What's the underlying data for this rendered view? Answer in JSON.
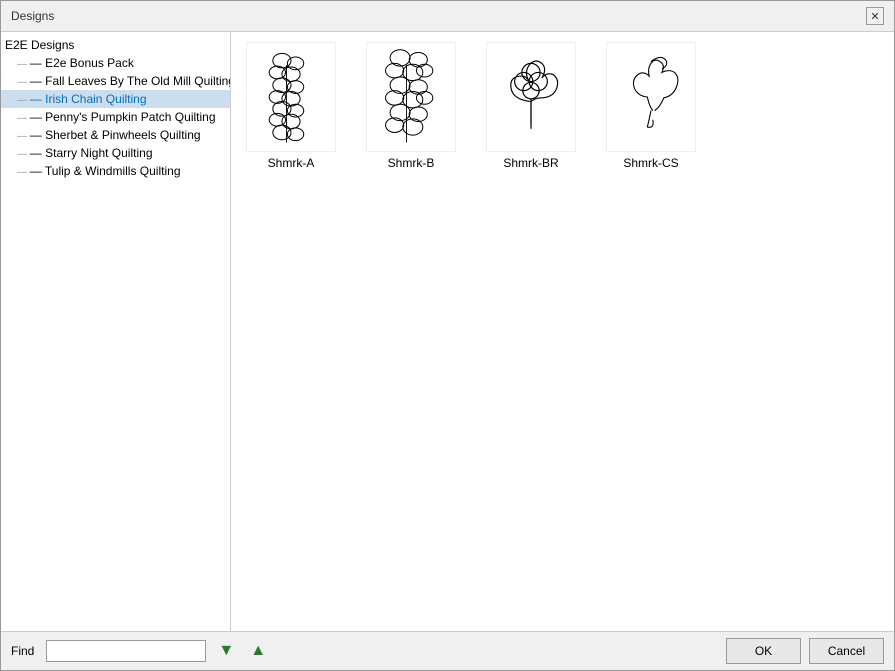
{
  "dialog": {
    "title": "Designs",
    "close_label": "✕"
  },
  "tree": {
    "items": [
      {
        "id": "e2e-designs",
        "label": "E2E Designs",
        "level": 0,
        "selected": false
      },
      {
        "id": "e2e-bonus-pack",
        "label": "E2e Bonus Pack",
        "level": 1,
        "selected": false
      },
      {
        "id": "fall-leaves",
        "label": "Fall Leaves By The Old Mill Quilting",
        "level": 1,
        "selected": false
      },
      {
        "id": "irish-chain",
        "label": "Irish Chain Quilting",
        "level": 1,
        "selected": true
      },
      {
        "id": "penny-pumpkin",
        "label": "Penny's Pumpkin Patch Quilting",
        "level": 1,
        "selected": false
      },
      {
        "id": "sherbet-pinwheels",
        "label": "Sherbet & Pinwheels Quilting",
        "level": 1,
        "selected": false
      },
      {
        "id": "starry-night",
        "label": "Starry Night Quilting",
        "level": 1,
        "selected": false
      },
      {
        "id": "tulip-windmills",
        "label": "Tulip & Windmills Quilting",
        "level": 1,
        "selected": false
      }
    ]
  },
  "designs": [
    {
      "id": "shmrk-a",
      "label": "Shmrk-A"
    },
    {
      "id": "shmrk-b",
      "label": "Shmrk-B"
    },
    {
      "id": "shmrk-br",
      "label": "Shmrk-BR"
    },
    {
      "id": "shmrk-cs",
      "label": "Shmrk-CS"
    }
  ],
  "bottom": {
    "find_label": "Find",
    "find_placeholder": "",
    "down_icon": "▼",
    "up_icon": "▲",
    "ok_label": "OK",
    "cancel_label": "Cancel"
  }
}
